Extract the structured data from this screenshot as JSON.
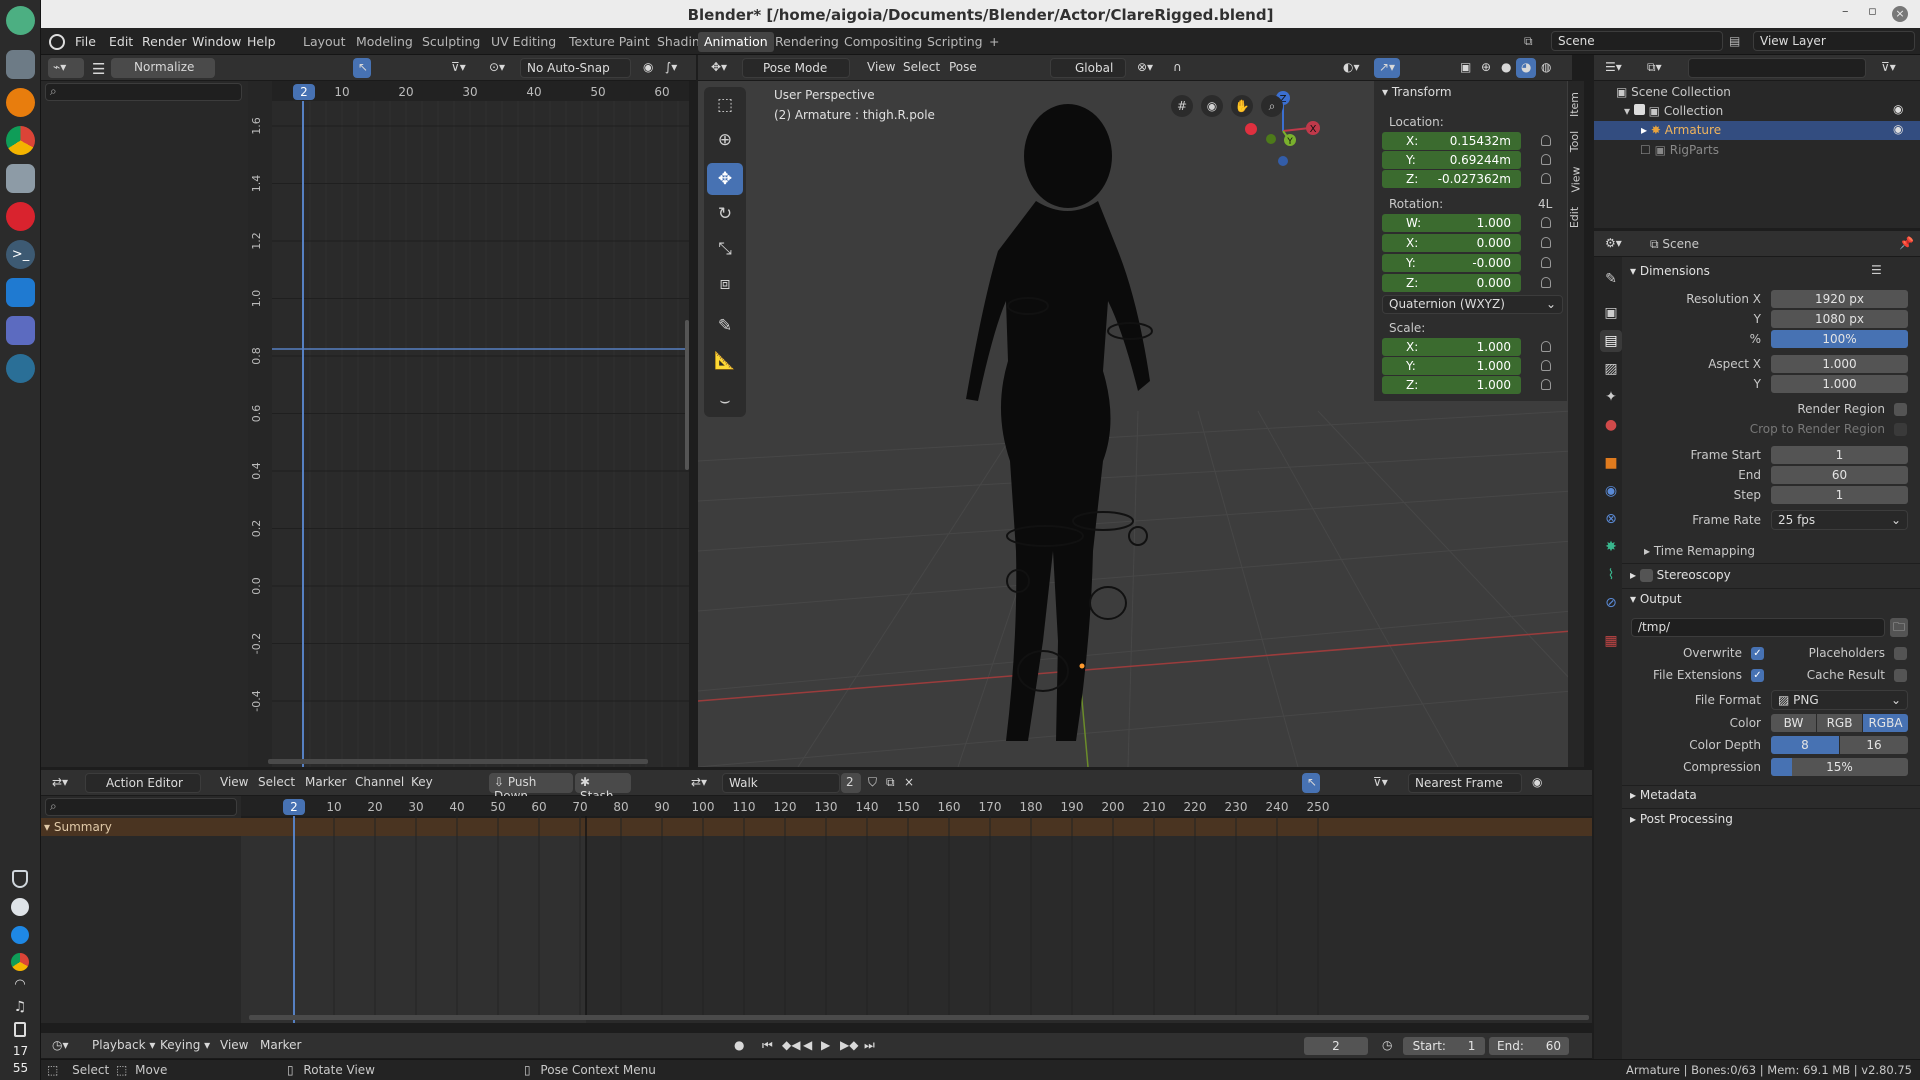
{
  "window": {
    "title": "Blender* [/home/aigoia/Documents/Blender/Actor/ClareRigged.blend]"
  },
  "menus": [
    "File",
    "Edit",
    "Render",
    "Window",
    "Help"
  ],
  "workspaces": [
    "Layout",
    "Modeling",
    "Sculpting",
    "UV Editing",
    "Texture Paint",
    "Shading",
    "Animation",
    "Rendering",
    "Compositing",
    "Scripting",
    "+"
  ],
  "scene_field": "Scene",
  "view_layer_field": "View Layer",
  "graph_editor": {
    "normalize": "Normalize",
    "snap": "No Auto-Snap",
    "frame_ticks": [
      "10",
      "20",
      "30",
      "40",
      "50",
      "60"
    ],
    "current_frame": "2",
    "value_ticks": [
      "1.6",
      "1.4",
      "1.2",
      "1.0",
      "0.8",
      "0.6",
      "0.4",
      "0.2",
      "0.0",
      "-0.2",
      "-0.4"
    ]
  },
  "viewport": {
    "mode": "Pose Mode",
    "menus": [
      "View",
      "Select",
      "Pose"
    ],
    "orientation": "Global",
    "perspective": "User Perspective",
    "active": "(2) Armature : thigh.R.pole",
    "side_tabs": [
      "Item",
      "Tool",
      "View",
      "Edit"
    ]
  },
  "transform": {
    "title": "Transform",
    "location_label": "Location:",
    "location": {
      "x": "0.15432m",
      "y": "0.69244m",
      "z": "-0.027362m"
    },
    "rotation_label": "Rotation:",
    "rotation_mode_badge": "4L",
    "rotation": {
      "w": "1.000",
      "x": "0.000",
      "y": "-0.000",
      "z": "0.000"
    },
    "rotation_mode": "Quaternion (WXYZ)",
    "scale_label": "Scale:",
    "scale": {
      "x": "1.000",
      "y": "1.000",
      "z": "1.000"
    },
    "axis_labels": {
      "w": "W:",
      "x": "X:",
      "y": "Y:",
      "z": "Z:"
    }
  },
  "outliner": {
    "scene_collection": "Scene Collection",
    "collection": "Collection",
    "armature": "Armature",
    "rigparts": "RigParts"
  },
  "properties": {
    "scene": "Scene",
    "dimensions": "Dimensions",
    "resolution_x_label": "Resolution X",
    "resolution_x": "1920 px",
    "y_label": "Y",
    "resolution_y": "1080 px",
    "percent_label": "%",
    "percent": "100%",
    "aspect_x_label": "Aspect X",
    "aspect_x": "1.000",
    "aspect_y": "1.000",
    "render_region": "Render Region",
    "crop": "Crop to Render Region",
    "frame_start_label": "Frame Start",
    "frame_start": "1",
    "end_label": "End",
    "frame_end": "60",
    "step_label": "Step",
    "step": "1",
    "frame_rate_label": "Frame Rate",
    "frame_rate": "25 fps",
    "time_remapping": "Time Remapping",
    "stereoscopy": "Stereoscopy",
    "output": "Output",
    "output_path": "/tmp/",
    "overwrite": "Overwrite",
    "placeholders": "Placeholders",
    "file_extensions": "File Extensions",
    "cache_result": "Cache Result",
    "file_format_label": "File Format",
    "file_format": "PNG",
    "color_label": "Color",
    "color_options": [
      "BW",
      "RGB",
      "RGBA"
    ],
    "color_depth_label": "Color Depth",
    "color_depth": [
      "8",
      "16"
    ],
    "compression_label": "Compression",
    "compression": "15%",
    "compression_level": 0.15,
    "metadata": "Metadata",
    "post_processing": "Post Processing"
  },
  "action_editor": {
    "mode": "Action Editor",
    "menus": [
      "View",
      "Select",
      "Marker",
      "Channel",
      "Key"
    ],
    "push_down": "Push Down",
    "stash": "Stash",
    "action": "Walk",
    "users": "2",
    "snap": "Nearest Frame",
    "current_frame": "2",
    "frame_ticks": [
      "10",
      "20",
      "30",
      "40",
      "50",
      "60",
      "70",
      "80",
      "90",
      "100",
      "110",
      "120",
      "130",
      "140",
      "150",
      "160",
      "170",
      "180",
      "190",
      "200",
      "210",
      "220",
      "230",
      "240",
      "250"
    ],
    "summary": "Summary"
  },
  "timeline": {
    "menus": [
      "Playback",
      "Keying",
      "View",
      "Marker"
    ],
    "current": "2",
    "start_label": "Start:",
    "start": "1",
    "end_label": "End:",
    "end": "60"
  },
  "status": {
    "select": "Select",
    "move": "Move",
    "rotate": "Rotate View",
    "context": "Pose Context Menu",
    "info": "Armature | Bones:0/63 | Mem: 69.1 MB | v2.80.75"
  },
  "clock": {
    "hour": "17",
    "minute": "55"
  },
  "colors": {
    "accent": "#4772b3",
    "green_field": "#3b6b2f",
    "orange_summary": "#4a3421"
  }
}
